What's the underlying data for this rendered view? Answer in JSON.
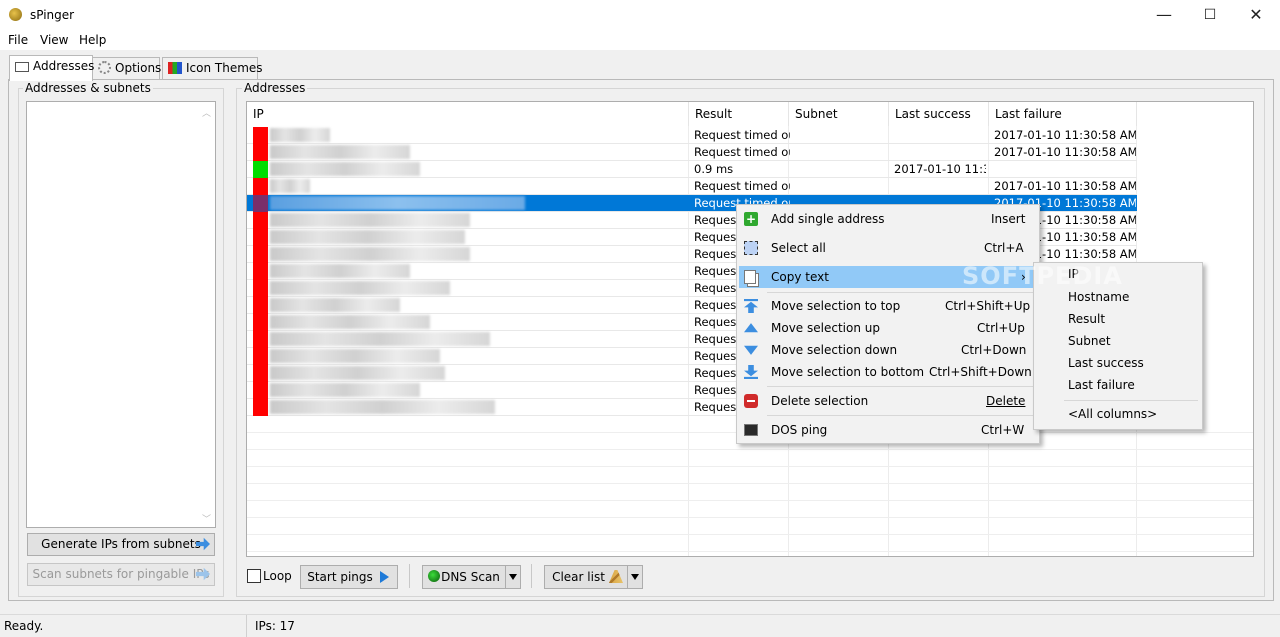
{
  "window": {
    "title": "sPinger",
    "minimize": "—",
    "maximize": "☐",
    "close": "✕"
  },
  "menu": [
    "File",
    "View",
    "Help"
  ],
  "tabs": [
    {
      "label": "Addresses",
      "icon": "addresses-tab-icon"
    },
    {
      "label": "Options",
      "icon": "gear-icon"
    },
    {
      "label": "Icon Themes",
      "icon": "themes-icon"
    }
  ],
  "left_panel": {
    "title": "Addresses & subnets",
    "generate_button": "Generate IPs from subnets",
    "scan_button": "Scan subnets for pingable IPs"
  },
  "addresses_panel": {
    "title": "Addresses",
    "columns": [
      "IP",
      "Result",
      "Subnet",
      "Last success",
      "Last failure"
    ],
    "rows": [
      {
        "status": "#ff0000",
        "result": "Request timed out",
        "subnet": "",
        "last_success": "",
        "last_failure": "2017-01-10 11:30:58 AM",
        "selected": false
      },
      {
        "status": "#ff0000",
        "result": "Request timed out",
        "subnet": "",
        "last_success": "",
        "last_failure": "2017-01-10 11:30:58 AM",
        "selected": false
      },
      {
        "status": "#00dd00",
        "result": "0.9 ms",
        "subnet": "",
        "last_success": "2017-01-10 11:3...",
        "last_failure": "",
        "selected": false
      },
      {
        "status": "#ff0000",
        "result": "Request timed out",
        "subnet": "",
        "last_success": "",
        "last_failure": "2017-01-10 11:30:58 AM",
        "selected": false
      },
      {
        "status": "#7a2f6a",
        "result": "Request timed out",
        "subnet": "",
        "last_success": "",
        "last_failure": "2017-01-10 11:30:58 AM",
        "selected": true
      },
      {
        "status": "#ff0000",
        "result": "Request",
        "subnet": "",
        "last_success": "",
        "last_failure": "2017-01-10 11:30:58 AM",
        "selected": false
      },
      {
        "status": "#ff0000",
        "result": "Request",
        "subnet": "",
        "last_success": "",
        "last_failure": "2017-01-10 11:30:58 AM",
        "selected": false
      },
      {
        "status": "#ff0000",
        "result": "Request",
        "subnet": "",
        "last_success": "",
        "last_failure": "2017-01-10 11:30:58 AM",
        "selected": false
      },
      {
        "status": "#ff0000",
        "result": "Request",
        "subnet": "",
        "last_success": "",
        "last_failure": "",
        "selected": false
      },
      {
        "status": "#ff0000",
        "result": "Request",
        "subnet": "",
        "last_success": "",
        "last_failure": "",
        "selected": false
      },
      {
        "status": "#ff0000",
        "result": "Request",
        "subnet": "",
        "last_success": "",
        "last_failure": "",
        "selected": false
      },
      {
        "status": "#ff0000",
        "result": "Request",
        "subnet": "",
        "last_success": "",
        "last_failure": "",
        "selected": false
      },
      {
        "status": "#ff0000",
        "result": "Request",
        "subnet": "",
        "last_success": "",
        "last_failure": "",
        "selected": false
      },
      {
        "status": "#ff0000",
        "result": "Request",
        "subnet": "",
        "last_success": "",
        "last_failure": "",
        "selected": false
      },
      {
        "status": "#ff0000",
        "result": "Request",
        "subnet": "",
        "last_success": "",
        "last_failure": "",
        "selected": false
      },
      {
        "status": "#ff0000",
        "result": "Request",
        "subnet": "",
        "last_success": "",
        "last_failure": "",
        "selected": false
      },
      {
        "status": "#ff0000",
        "result": "Request",
        "subnet": "",
        "last_success": "",
        "last_failure": "",
        "selected": false
      }
    ]
  },
  "toolbar": {
    "loop_label": "Loop",
    "loop_checked": false,
    "start_button": "Start pings",
    "dns_button": "DNS Scan",
    "clear_button": "Clear list"
  },
  "context_menu": {
    "items": [
      {
        "label": "Add single address",
        "shortcut": "Insert",
        "icon": "add-icon"
      },
      {
        "label": "Select all",
        "shortcut": "Ctrl+A",
        "icon": "select-all-icon"
      },
      {
        "label": "Copy text",
        "shortcut": "›",
        "icon": "copy-icon",
        "highlighted": true
      },
      {
        "label": "Move selection to top",
        "shortcut": "Ctrl+Shift+Up",
        "icon": "move-top-icon"
      },
      {
        "label": "Move selection up",
        "shortcut": "Ctrl+Up",
        "icon": "move-up-icon"
      },
      {
        "label": "Move selection down",
        "shortcut": "Ctrl+Down",
        "icon": "move-down-icon"
      },
      {
        "label": "Move selection to bottom",
        "shortcut": "Ctrl+Shift+Down",
        "icon": "move-bottom-icon"
      },
      {
        "label": "Delete selection",
        "shortcut": "Delete",
        "icon": "delete-icon"
      },
      {
        "label": "DOS ping",
        "shortcut": "Ctrl+W",
        "icon": "console-icon"
      }
    ]
  },
  "submenu": {
    "items": [
      "IP",
      "Hostname",
      "Result",
      "Subnet",
      "Last success",
      "Last failure",
      "<All columns>"
    ]
  },
  "watermark": "SOFTPEDIA",
  "statusbar": {
    "status": "Ready.",
    "count": "IPs: 17"
  }
}
